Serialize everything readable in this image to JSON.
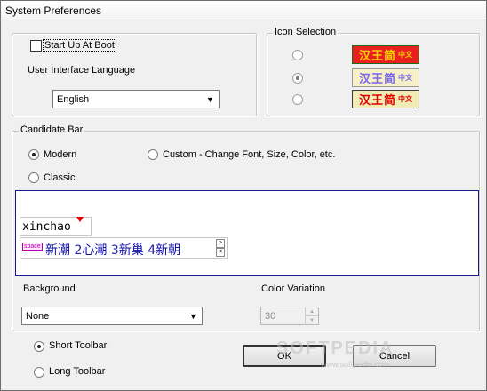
{
  "window": {
    "title": "System Preferences"
  },
  "general": {
    "startup_label": "Start Up At Boot",
    "startup_checked": false,
    "language_label": "User Interface Language",
    "language_value": "English"
  },
  "icon_selection": {
    "legend": "Icon Selection",
    "options": [
      {
        "text": "汉王简",
        "small": "中文",
        "bg": "#e82020",
        "fg": "#f0d000",
        "border": "#1a6a1a",
        "selected": false
      },
      {
        "text": "汉王简",
        "small": "中文",
        "bg": "#f6f0c8",
        "fg": "#7b68ee",
        "border": "#9a9a9a",
        "selected": true
      },
      {
        "text": "汉王简",
        "small": "中文",
        "bg": "#f2ecb4",
        "fg": "#e00000",
        "border": "#3c3c3c",
        "selected": false
      }
    ]
  },
  "candidate_bar": {
    "legend": "Candidate Bar",
    "modern_label": "Modern",
    "custom_label": "Custom - Change Font, Size, Color, etc.",
    "classic_label": "Classic",
    "selected": "modern",
    "preview": {
      "pinyin": "xinchao",
      "space_label": "space",
      "candidates": [
        {
          "num": "",
          "text": "新潮"
        },
        {
          "num": "2",
          "text": "心潮"
        },
        {
          "num": "3",
          "text": "新巢"
        },
        {
          "num": "4",
          "text": "新朝"
        }
      ],
      "next_label": ">",
      "prev_label": "<"
    }
  },
  "background": {
    "label": "Background",
    "value": "None"
  },
  "color_variation": {
    "label": "Color Variation",
    "value": "30"
  },
  "toolbar": {
    "short_label": "Short Toolbar",
    "long_label": "Long Toolbar",
    "selected": "short"
  },
  "buttons": {
    "ok_label": "OK",
    "cancel_label": "Cancel"
  },
  "watermark": {
    "text": "SOFTPEDIA",
    "url": "www.softpedia.com"
  },
  "colors": {
    "window_bg": "#f0f0f0",
    "preview_border": "#1a1a8a"
  }
}
